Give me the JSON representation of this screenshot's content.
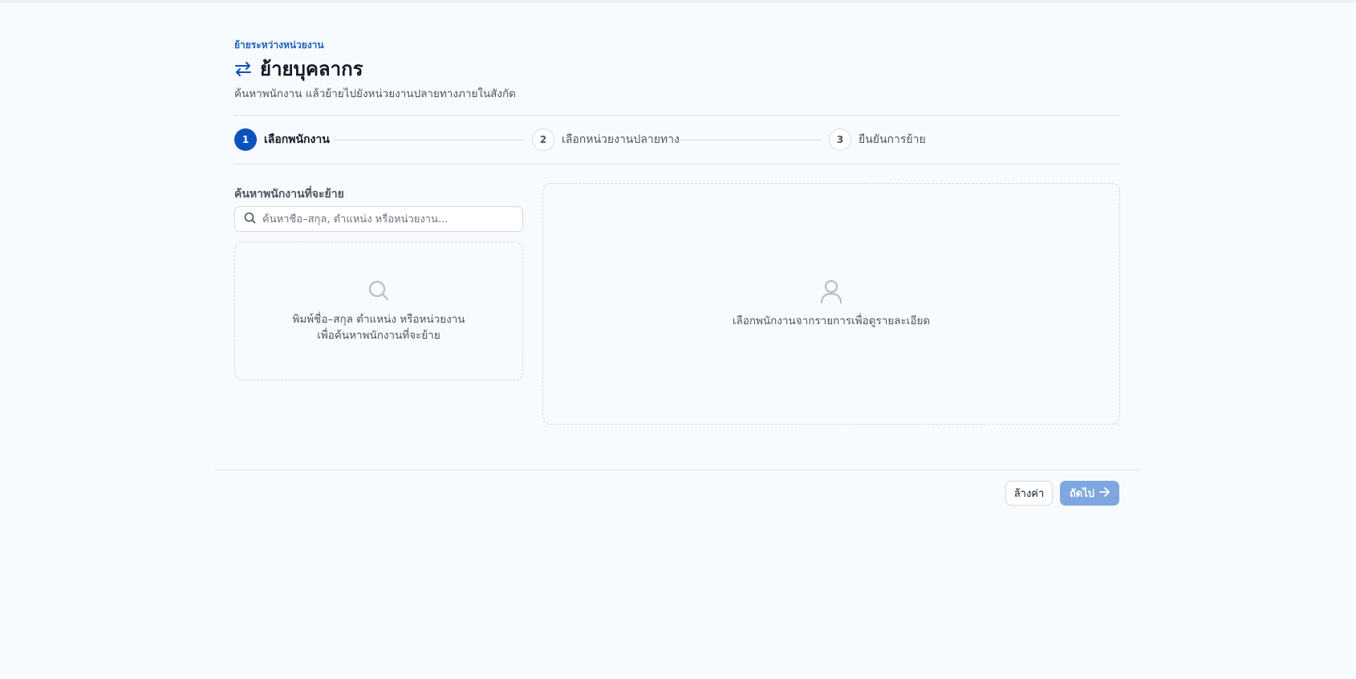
{
  "header": {
    "breadcrumb": "ย้ายระหว่างหน่วยงาน",
    "title": "ย้ายบุคลากร",
    "subtitle": "ค้นหาพนักงาน แล้วย้ายไปยังหน่วยงานปลายทางภายในสังกัด",
    "title_icon": "transfer-arrows-icon"
  },
  "stepper": {
    "steps": [
      {
        "number": "1",
        "label": "เลือกพนักงาน",
        "state": "active"
      },
      {
        "number": "2",
        "label": "เลือกหน่วยงานปลายทาง",
        "state": "idle"
      },
      {
        "number": "3",
        "label": "ยืนยันการย้าย",
        "state": "idle"
      }
    ]
  },
  "search": {
    "label": "ค้นหาพนักงานที่จะย้าย",
    "value": "",
    "placeholder": "ค้นหาชื่อ–สกุล, ตำแหน่ง หรือหน่วยงาน...",
    "icon": "search-icon"
  },
  "results_empty": {
    "icon": "search-icon",
    "line1": "พิมพ์ชื่อ–สกุล ตำแหน่ง หรือหน่วยงาน",
    "line2": "เพื่อค้นหาพนักงานที่จะย้าย"
  },
  "detail_empty": {
    "icon": "user-icon",
    "message": "เลือกพนักงานจากรายการเพื่อดูรายละเอียด"
  },
  "footer": {
    "reset_label": "ล้างค่า",
    "next_label": "ถัดไป",
    "next_icon": "arrow-right-icon"
  },
  "colors": {
    "accent": "#0b52bf",
    "accent_disabled": "#7fa7df",
    "background": "#f8fbfd",
    "border": "#d3d9e1"
  }
}
